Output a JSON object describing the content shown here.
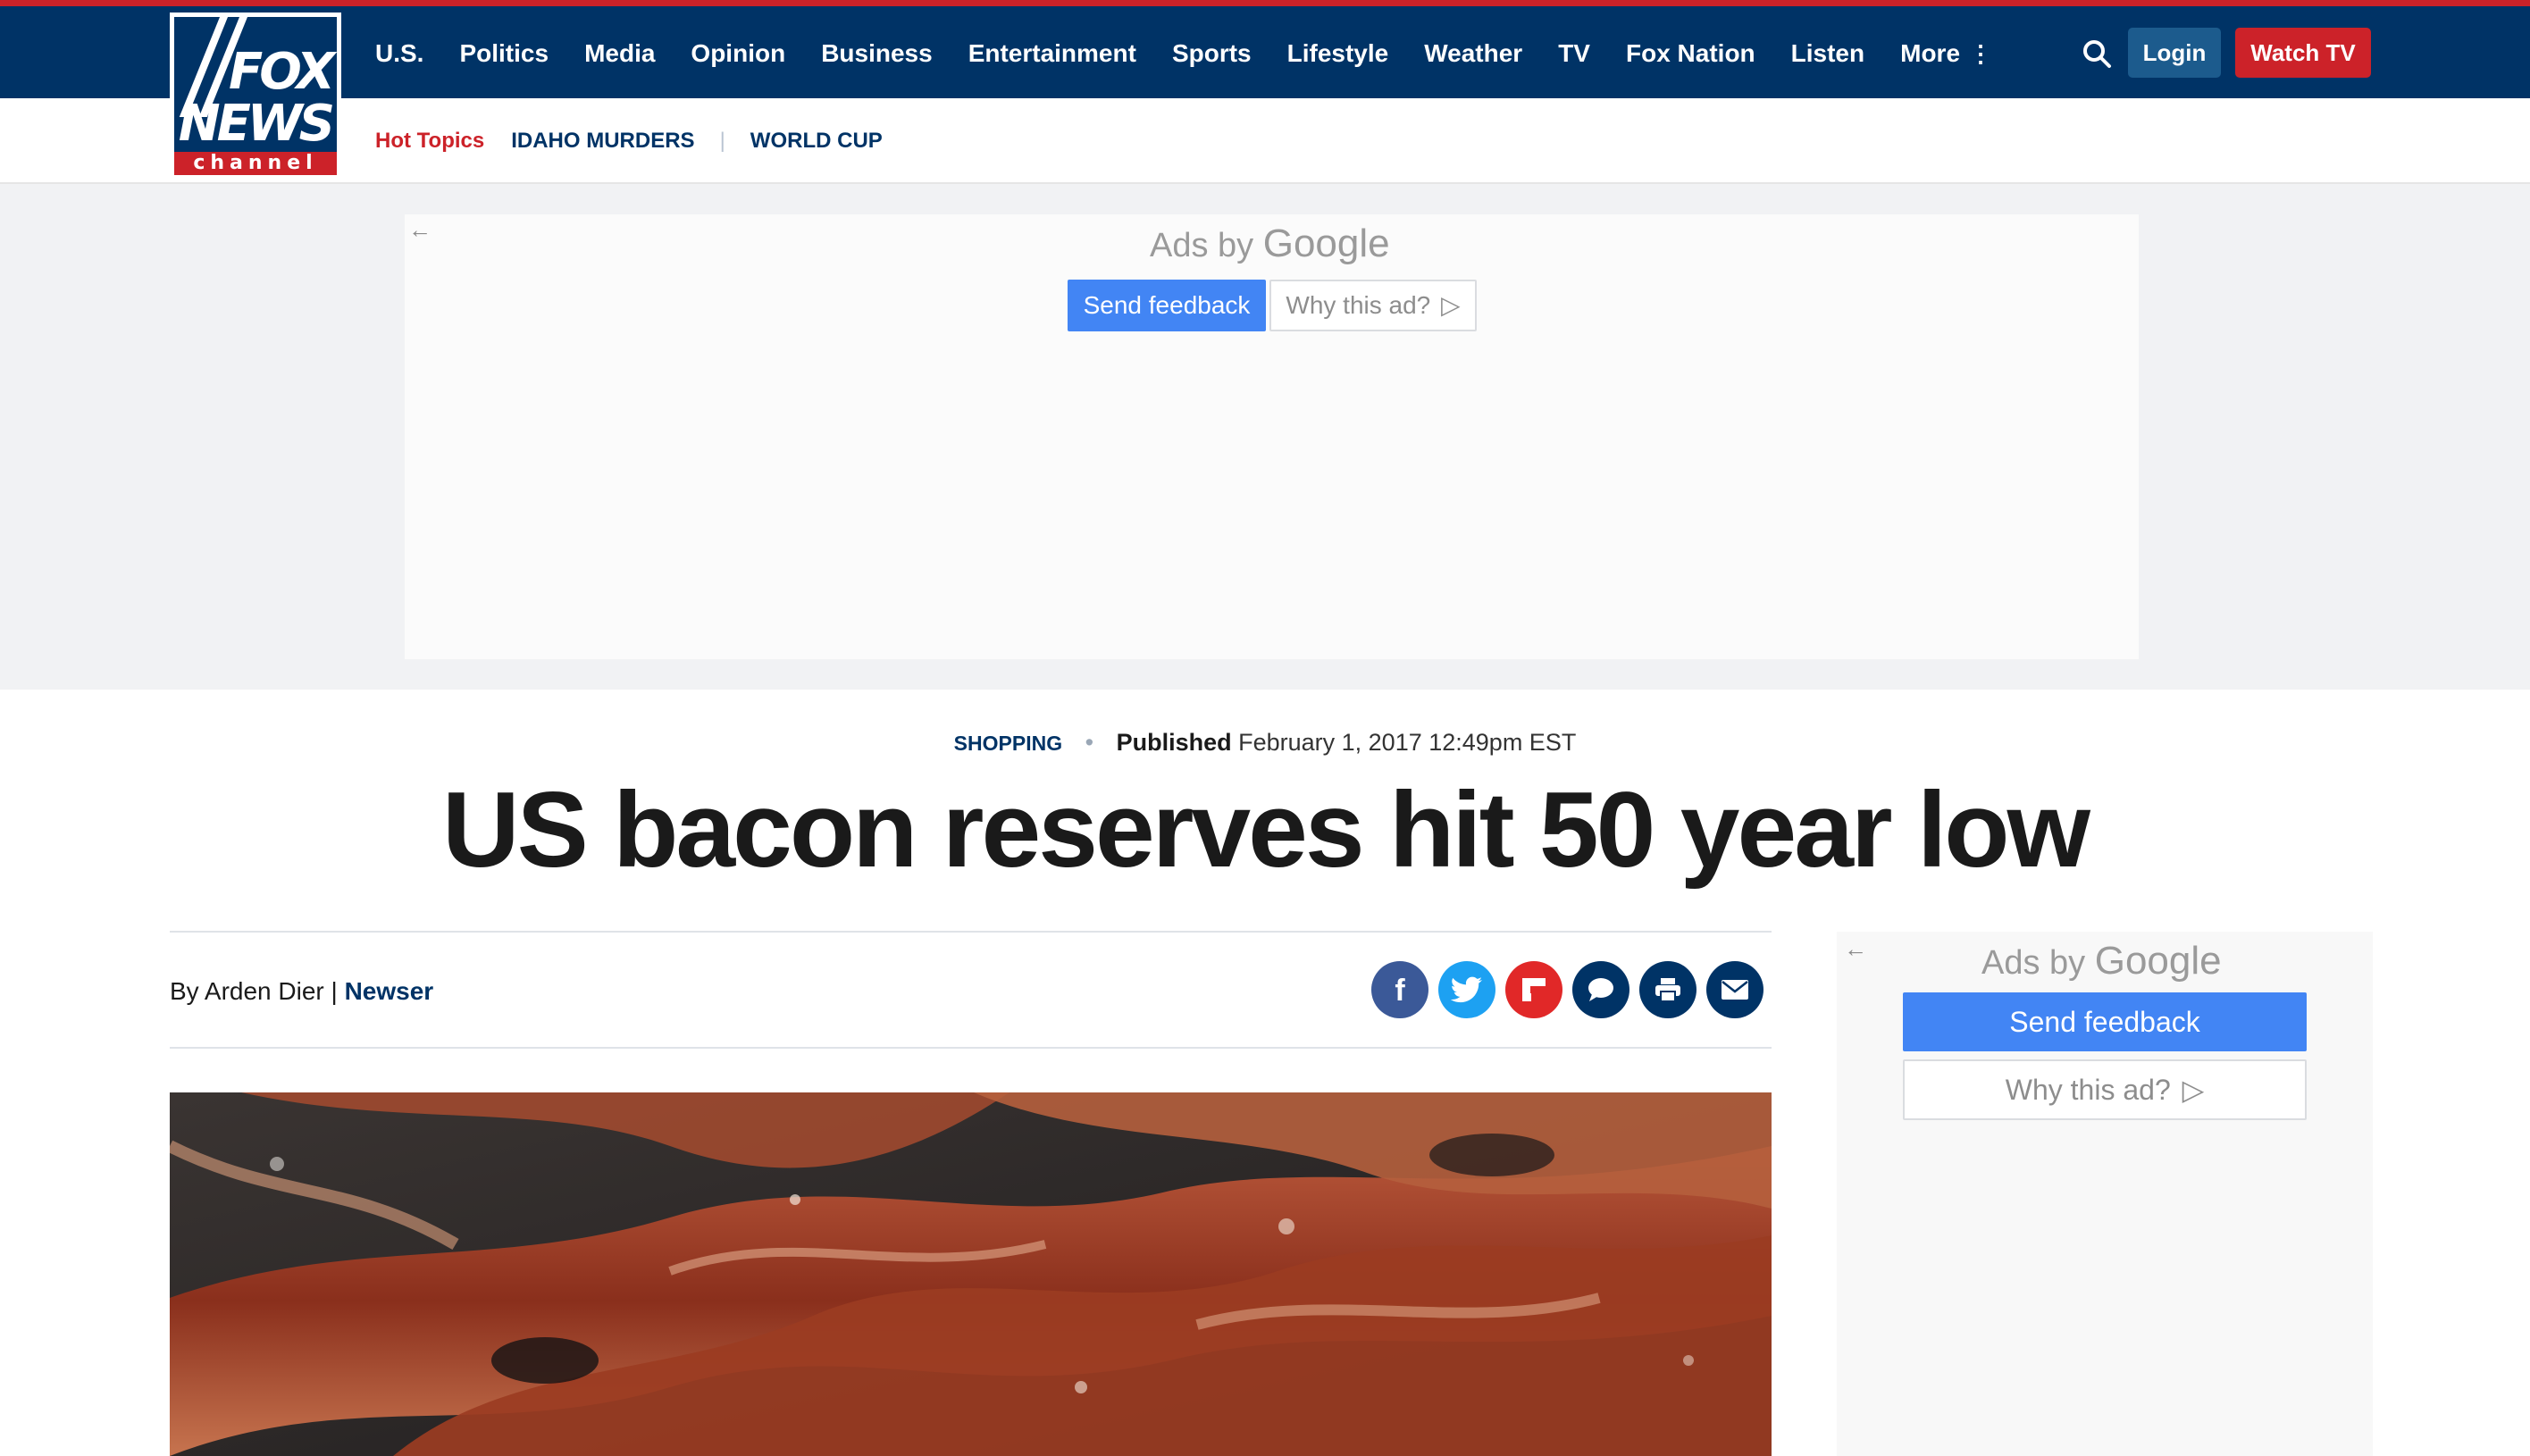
{
  "header": {
    "logo": {
      "word1": "FOX",
      "word2": "NEWS",
      "channel": "channel"
    },
    "nav": [
      "U.S.",
      "Politics",
      "Media",
      "Opinion",
      "Business",
      "Entertainment",
      "Sports",
      "Lifestyle",
      "Weather",
      "TV",
      "Fox Nation",
      "Listen",
      "More"
    ],
    "login_label": "Login",
    "watch_label": "Watch TV",
    "colors": {
      "navy": "#003366",
      "red": "#cc2229",
      "login_blue": "#1c5b8d"
    }
  },
  "hot_topics": {
    "label": "Hot Topics",
    "items": [
      "IDAHO MURDERS",
      "WORLD CUP"
    ]
  },
  "ads": {
    "ads_by": "Ads by",
    "google": "Google",
    "send_feedback": "Send feedback",
    "why_this_ad": "Why this ad?",
    "back_arrow": "←"
  },
  "article": {
    "category": "SHOPPING",
    "published_label": "Published",
    "published_date": "February 1, 2017 12:49pm EST",
    "headline": "US bacon reserves hit 50 year low",
    "byline_prefix": "By Arden Dier |",
    "byline_source": "Newser",
    "share_icons": [
      {
        "name": "facebook-icon",
        "color": "#3b5998"
      },
      {
        "name": "twitter-icon",
        "color": "#1da1f2"
      },
      {
        "name": "flipboard-icon",
        "color": "#e12828"
      },
      {
        "name": "comments-icon",
        "color": "#003366"
      },
      {
        "name": "print-icon",
        "color": "#003366"
      },
      {
        "name": "email-icon",
        "color": "#003366"
      }
    ],
    "hero_image": "bacon-photo"
  }
}
